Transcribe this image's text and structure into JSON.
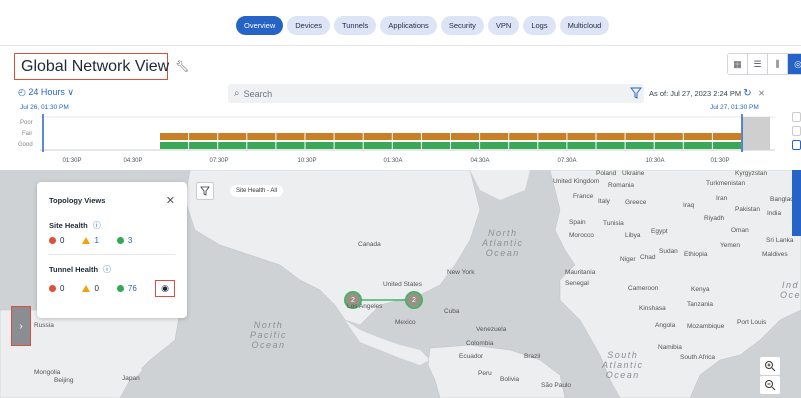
{
  "tabs": [
    "Overview",
    "Devices",
    "Tunnels",
    "Applications",
    "Security",
    "VPN",
    "Logs",
    "Multicloud"
  ],
  "active_tab": "Overview",
  "title": "Global Network View",
  "time_range": "24 Hours",
  "search_placeholder": "Search",
  "as_of": "As of: Jul 27, 2023 2:24 PM",
  "timeline": {
    "start_label": "Jul 26, 01:30 PM",
    "end_label": "Jul 27, 01:30 PM",
    "y_labels": [
      "Poor",
      "Fair",
      "Good"
    ],
    "x_ticks": [
      "01:30P",
      "04:30P",
      "07:30P",
      "10:30P",
      "01:30A",
      "04:30A",
      "07:30A",
      "10:30A",
      "01:30P"
    ],
    "colors": {
      "fair": "#c98024",
      "good": "#3aa856",
      "marker": "#2563c6"
    }
  },
  "map": {
    "filter_pill": "Site Health - All",
    "labels": {
      "canada": "Canada",
      "us": "United States",
      "mexico": "Mexico",
      "cuba": "Cuba",
      "newyork": "New York",
      "venezuela": "Venezuela",
      "colombia": "Colombia",
      "ecuador": "Ecuador",
      "peru": "Peru",
      "bolivia": "Bolivia",
      "brazil": "Brazil",
      "saopaulo": "São Paulo",
      "russia": "Russia",
      "mongolia": "Mongolia",
      "beijing": "Beijing",
      "japan": "Japan",
      "uk": "United Kingdom",
      "poland": "Poland",
      "ukraine": "Ukraine",
      "romania": "Romania",
      "france": "France",
      "italy": "Italy",
      "greece": "Greece",
      "spain": "Spain",
      "tunisia": "Tunisia",
      "morocco": "Morocco",
      "libya": "Libya",
      "egypt": "Egypt",
      "iraq": "Iraq",
      "iran": "Iran",
      "turkmenistan": "Turkmenistan",
      "kyrgyzstan": "Kyrgyzstan",
      "pakistan": "Pakistan",
      "india": "India",
      "bangladesh": "Bangladesh",
      "riyadh": "Riyadh",
      "oman": "Oman",
      "yemen": "Yemen",
      "sudan": "Sudan",
      "ethiopia": "Ethiopia",
      "chad": "Chad",
      "niger": "Niger",
      "mauritania": "Mauritania",
      "senegal": "Senegal",
      "cameroon": "Cameroon",
      "kenya": "Kenya",
      "kinshasa": "Kinshasa",
      "tanzania": "Tanzania",
      "angola": "Angola",
      "mozambique": "Mozambique",
      "namibia": "Namibia",
      "southafrica": "South Africa",
      "srilanka": "Sri Lanka",
      "maldives": "Maldives",
      "portlouis": "Port Louis",
      "losangeles": "Los Angeles"
    },
    "oceans": {
      "natl": "North\nAtlantic\nOcean",
      "npac": "North\nPacific\nOcean",
      "satl": "South\nAtlantic\nOcean",
      "ind": "Ind\nOce"
    },
    "sites": [
      {
        "count": "2"
      },
      {
        "count": "2"
      }
    ]
  },
  "topology": {
    "title": "Topology Views",
    "site_health": {
      "label": "Site Health",
      "red": "0",
      "yellow": "1",
      "green": "3"
    },
    "tunnel_health": {
      "label": "Tunnel Health",
      "red": "0",
      "yellow": "0",
      "green": "76"
    }
  }
}
